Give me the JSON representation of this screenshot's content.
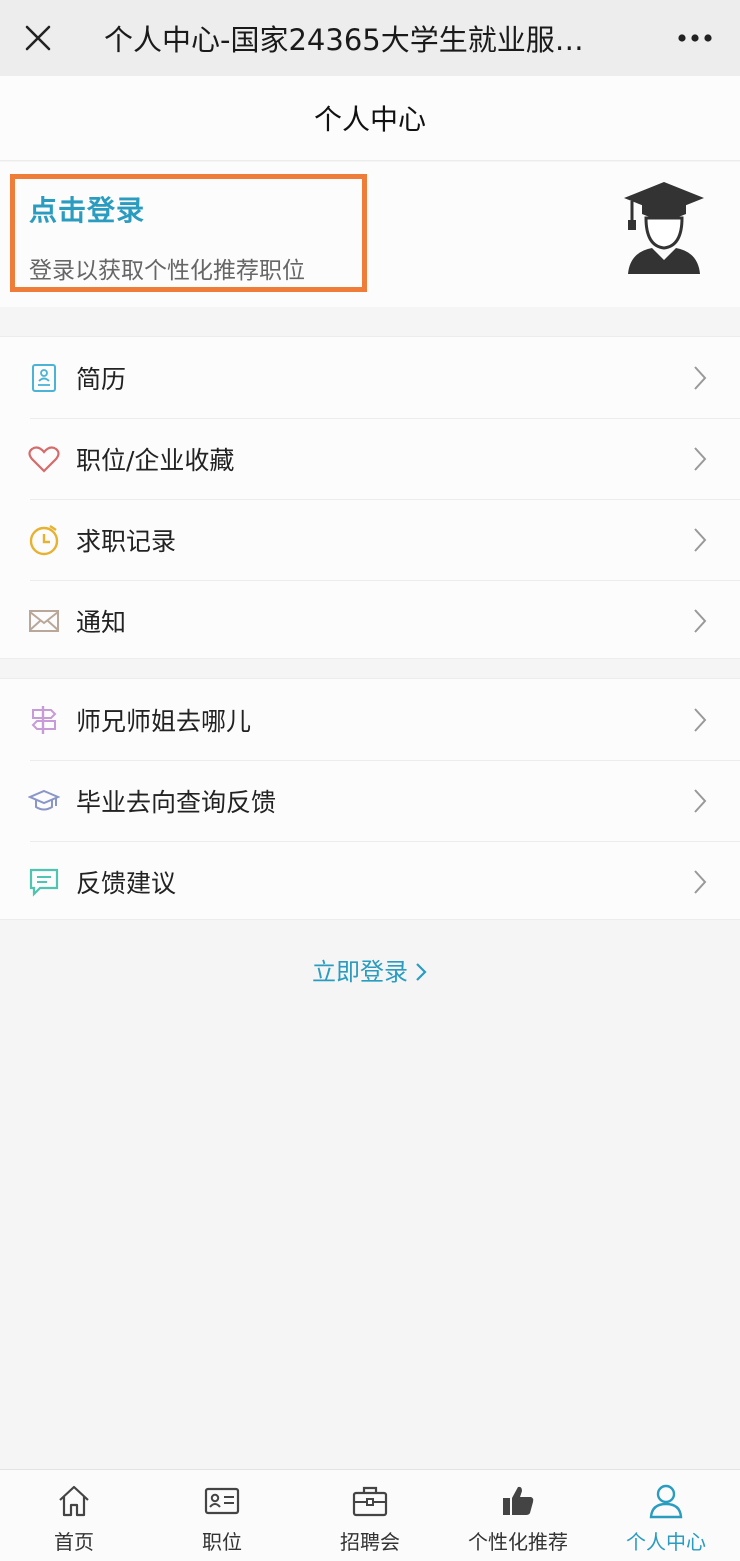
{
  "window": {
    "title": "个人中心-国家24365大学生就业服…"
  },
  "page": {
    "title": "个人中心"
  },
  "login": {
    "title": "点击登录",
    "subtitle": "登录以获取个性化推荐职位"
  },
  "menu_group_1": [
    {
      "label": "简历",
      "icon": "resume-icon"
    },
    {
      "label": "职位/企业收藏",
      "icon": "heart-icon"
    },
    {
      "label": "求职记录",
      "icon": "clock-icon"
    },
    {
      "label": "通知",
      "icon": "envelope-icon"
    }
  ],
  "menu_group_2": [
    {
      "label": "师兄师姐去哪儿",
      "icon": "signpost-icon"
    },
    {
      "label": "毕业去向查询反馈",
      "icon": "graduation-cap-icon"
    },
    {
      "label": "反馈建议",
      "icon": "message-icon"
    }
  ],
  "login_link": {
    "label": "立即登录"
  },
  "bottom_nav": [
    {
      "label": "首页",
      "icon": "home-icon"
    },
    {
      "label": "职位",
      "icon": "id-card-icon"
    },
    {
      "label": "招聘会",
      "icon": "briefcase-icon"
    },
    {
      "label": "个性化推荐",
      "icon": "thumbs-up-icon"
    },
    {
      "label": "个人中心",
      "icon": "user-icon",
      "active": true
    }
  ],
  "colors": {
    "accent": "#2a9cc0",
    "highlight_border": "#f07c3a"
  }
}
